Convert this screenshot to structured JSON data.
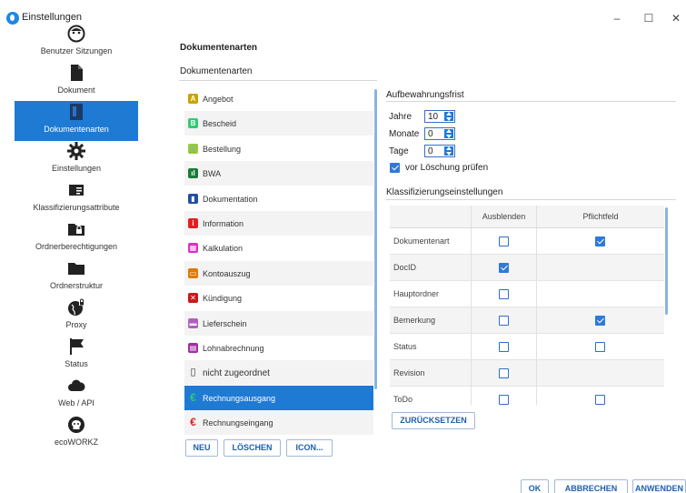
{
  "window": {
    "title": "Einstellungen",
    "controls": {
      "minimize": "–",
      "maximize": "☐",
      "close": "✕"
    }
  },
  "colors": {
    "accent": "#1f7ad4",
    "button_text": "#1c5fb0"
  },
  "nav": {
    "items": [
      {
        "label": "Benutzer Sitzungen",
        "icon": "user-face-icon",
        "active": false
      },
      {
        "label": "Dokument",
        "icon": "document-icon",
        "active": false
      },
      {
        "label": "Dokumentenarten",
        "icon": "document-types-icon",
        "active": true
      },
      {
        "label": "Einstellungen",
        "icon": "gear-icon",
        "active": false
      },
      {
        "label": "Klassifizierungsattribute",
        "icon": "id-card-icon",
        "active": false
      },
      {
        "label": "Ordnerberechtigungen",
        "icon": "locked-folder-icon",
        "active": false
      },
      {
        "label": "Ordnerstruktur",
        "icon": "folder-icon",
        "active": false
      },
      {
        "label": "Proxy",
        "icon": "globe-lock-icon",
        "active": false
      },
      {
        "label": "Status",
        "icon": "flag-icon",
        "active": false
      },
      {
        "label": "Web / API",
        "icon": "cloud-icon",
        "active": false
      },
      {
        "label": "ecoWORKZ",
        "icon": "ecoworkz-logo-icon",
        "active": false
      }
    ]
  },
  "main": {
    "heading": "Dokumentenarten",
    "subheading": "Dokumentenarten",
    "doc_types": [
      {
        "label": "Angebot",
        "icon": "offer-icon",
        "color": "#c9a400",
        "glyph": "A"
      },
      {
        "label": "Bescheid",
        "icon": "notice-icon",
        "color": "#2ecc71",
        "glyph": "B"
      },
      {
        "label": "Bestellung",
        "icon": "cart-icon",
        "color": "#9acd32",
        "glyph": "🛒"
      },
      {
        "label": "BWA",
        "icon": "bwa-chart-icon",
        "color": "#1b7a3a",
        "glyph": "ıl"
      },
      {
        "label": "Dokumentation",
        "icon": "book-icon",
        "color": "#1f4fa0",
        "glyph": "▮"
      },
      {
        "label": "Information",
        "icon": "info-icon",
        "color": "#e02020",
        "glyph": "i"
      },
      {
        "label": "Kalkulation",
        "icon": "calculator-icon",
        "color": "#d633c8",
        "glyph": "▦"
      },
      {
        "label": "Kontoauszug",
        "icon": "bank-card-icon",
        "color": "#e07a00",
        "glyph": "▭"
      },
      {
        "label": "Kündigung",
        "icon": "cancel-icon",
        "color": "#c81a1a",
        "glyph": "✕"
      },
      {
        "label": "Lieferschein",
        "icon": "truck-icon",
        "color": "#b060c0",
        "glyph": "▬"
      },
      {
        "label": "Lohnabrechnung",
        "icon": "payroll-icon",
        "color": "#a030a0",
        "glyph": "▤"
      },
      {
        "label": "nicht zugeordnet",
        "icon": "blank-document-icon",
        "color": "#333333",
        "glyph": "▯"
      },
      {
        "label": "Rechnungsausgang",
        "icon": "euro-out-icon",
        "color": "#1faa3a",
        "glyph": "€"
      },
      {
        "label": "Rechnungseingang",
        "icon": "euro-in-icon",
        "color": "#e02020",
        "glyph": "€"
      }
    ],
    "selected_index": 12,
    "buttons": {
      "new": "NEU",
      "delete": "LÖSCHEN",
      "icon": "ICON..."
    }
  },
  "retention": {
    "heading": "Aufbewahrungsfrist",
    "years_label": "Jahre",
    "years_value": "10",
    "months_label": "Monate",
    "months_value": "0",
    "days_label": "Tage",
    "days_value": "0",
    "check_before_delete_label": "vor Löschung prüfen",
    "check_before_delete": true
  },
  "classification": {
    "heading": "Klassifizierungseinstellungen",
    "columns": [
      "",
      "Ausblenden",
      "Pflichtfeld"
    ],
    "rows": [
      {
        "name": "Dokumentenart",
        "hide": false,
        "required": true,
        "has_required": true
      },
      {
        "name": "DocID",
        "hide": true,
        "required": false,
        "has_required": false
      },
      {
        "name": "Hauptordner",
        "hide": false,
        "required": false,
        "has_required": false
      },
      {
        "name": "Bemerkung",
        "hide": false,
        "required": true,
        "has_required": true
      },
      {
        "name": "Status",
        "hide": false,
        "required": false,
        "has_required": true
      },
      {
        "name": "Revision",
        "hide": false,
        "required": false,
        "has_required": false
      },
      {
        "name": "ToDo",
        "hide": false,
        "required": false,
        "has_required": true
      }
    ],
    "reset_label": "ZURÜCKSETZEN"
  },
  "footer": {
    "ok": "OK",
    "cancel": "ABBRECHEN",
    "apply": "ANWENDEN"
  }
}
